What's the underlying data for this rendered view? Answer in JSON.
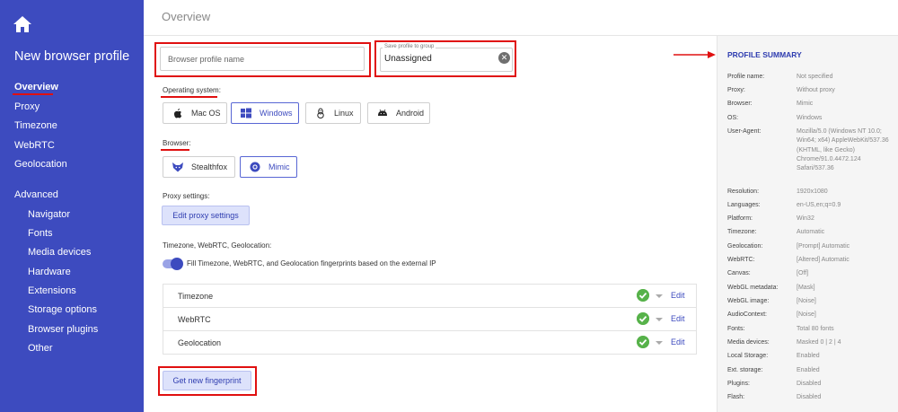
{
  "sidebar": {
    "title": "New browser profile",
    "items": [
      {
        "label": "Overview"
      },
      {
        "label": "Proxy"
      },
      {
        "label": "Timezone"
      },
      {
        "label": "WebRTC"
      },
      {
        "label": "Geolocation"
      }
    ],
    "advanced_label": "Advanced",
    "advanced_items": [
      {
        "label": "Navigator"
      },
      {
        "label": "Fonts"
      },
      {
        "label": "Media devices"
      },
      {
        "label": "Hardware"
      },
      {
        "label": "Extensions"
      },
      {
        "label": "Storage options"
      },
      {
        "label": "Browser plugins"
      },
      {
        "label": "Other"
      }
    ]
  },
  "header": {
    "title": "Overview"
  },
  "form": {
    "profile_name_placeholder": "Browser profile name",
    "group_legend": "Save profile to group",
    "group_value": "Unassigned",
    "os_label": "Operating system:",
    "os_options": [
      {
        "label": "Mac OS",
        "icon": "apple-icon",
        "selected": false
      },
      {
        "label": "Windows",
        "icon": "windows-icon",
        "selected": true
      },
      {
        "label": "Linux",
        "icon": "linux-icon",
        "selected": false
      },
      {
        "label": "Android",
        "icon": "android-icon",
        "selected": false
      }
    ],
    "browser_label": "Browser:",
    "browser_options": [
      {
        "label": "Stealthfox",
        "icon": "stealthfox-icon",
        "selected": false
      },
      {
        "label": "Mimic",
        "icon": "mimic-icon",
        "selected": true
      }
    ],
    "proxy_label": "Proxy settings:",
    "proxy_button": "Edit proxy settings",
    "tz_label": "Timezone, WebRTC, Geolocation:",
    "toggle_text": "Fill Timezone, WebRTC, and Geolocation fingerprints based on the external IP",
    "toggle_on": true,
    "fingerprint_rows": [
      {
        "name": "Timezone",
        "edit": "Edit"
      },
      {
        "name": "WebRTC",
        "edit": "Edit"
      },
      {
        "name": "Geolocation",
        "edit": "Edit"
      }
    ],
    "fingerprint_button": "Get new fingerprint"
  },
  "summary": {
    "title": "PROFILE SUMMARY",
    "rows": [
      {
        "key": "Profile name:",
        "value": "Not specified"
      },
      {
        "key": "Proxy:",
        "value": "Without proxy"
      },
      {
        "key": "Browser:",
        "value": "Mimic"
      },
      {
        "key": "OS:",
        "value": "Windows"
      },
      {
        "key": "User-Agent:",
        "value": "Mozilla/5.0 (Windows NT 10.0; Win64; x64) AppleWebKit/537.36 (KHTML, like Gecko) Chrome/91.0.4472.124 Safari/537.36"
      },
      {
        "key": "Resolution:",
        "value": "1920x1080"
      },
      {
        "key": "Languages:",
        "value": "en-US,en;q=0.9"
      },
      {
        "key": "Platform:",
        "value": "Win32"
      },
      {
        "key": "Timezone:",
        "value": "Automatic"
      },
      {
        "key": "Geolocation:",
        "value": "[Prompt] Automatic"
      },
      {
        "key": "WebRTC:",
        "value": "[Altered] Automatic"
      },
      {
        "key": "Canvas:",
        "value": "[Off]"
      },
      {
        "key": "WebGL metadata:",
        "value": "[Mask]"
      },
      {
        "key": "WebGL image:",
        "value": "[Noise]"
      },
      {
        "key": "AudioContext:",
        "value": "[Noise]"
      },
      {
        "key": "Fonts:",
        "value": "Total 80 fonts"
      },
      {
        "key": "Media devices:",
        "value": "Masked 0 | 2 | 4"
      },
      {
        "key": "Local Storage:",
        "value": "Enabled"
      },
      {
        "key": "Ext. storage:",
        "value": "Enabled"
      },
      {
        "key": "Plugins:",
        "value": "Disabled"
      },
      {
        "key": "Flash:",
        "value": "Disabled"
      }
    ]
  },
  "colors": {
    "sidebar": "#3d4bbf",
    "accent": "#3d4bbf",
    "highlight_red": "#e01010",
    "check_green": "#57b24a"
  }
}
